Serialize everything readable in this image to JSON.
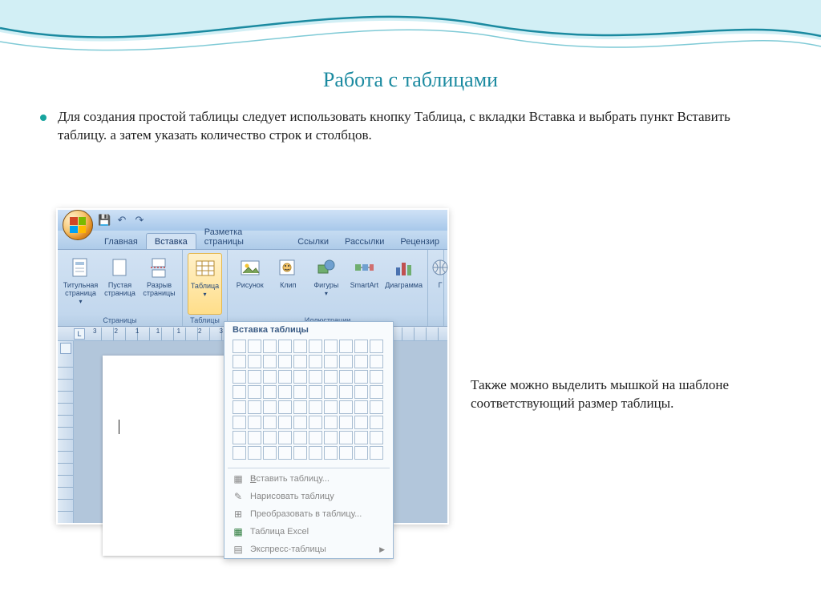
{
  "slide": {
    "title": "Работа с таблицами",
    "bullet1": "Для создания простой таблицы следует использовать кнопку Таблица, с вкладки Вставка и выбрать пункт Вставить таблицу. а затем указать количество строк и столбцов.",
    "side_text": " Также можно  выделить мышкой на шаблоне соответствующий размер таблицы."
  },
  "word": {
    "qat": {
      "save": "💾",
      "undo": "↶",
      "redo": "↷"
    },
    "tabs": {
      "home": "Главная",
      "insert": "Вставка",
      "layout": "Разметка страницы",
      "refs": "Ссылки",
      "mail": "Рассылки",
      "review": "Рецензир"
    },
    "ribbon": {
      "pages": {
        "cover": "Титульная\nстраница",
        "blank": "Пустая\nстраница",
        "break": "Разрыв\nстраницы",
        "label": "Страницы"
      },
      "tables": {
        "table": "Таблица",
        "label": "Таблицы"
      },
      "illustrations": {
        "picture": "Рисунок",
        "clip": "Клип",
        "shapes": "Фигуры",
        "smartart": "SmartArt",
        "chart": "Диаграмма",
        "label": "Иллюстрации"
      },
      "links_group": "Г"
    },
    "ruler_numbers": "3211123",
    "dropdown": {
      "header": "Вставка таблицы",
      "insert": "Вставить таблицу...",
      "draw": "Нарисовать таблицу",
      "convert": "Преобразовать в таблицу...",
      "excel": "Таблица Excel",
      "quick": "Экспресс-таблицы"
    }
  }
}
